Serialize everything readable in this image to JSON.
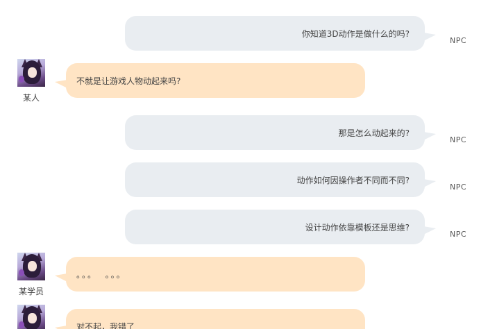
{
  "colors": {
    "npc_bubble": "#e9edf1",
    "user_bubble": "#ffe4c4",
    "text": "#444444",
    "background": "#ffffff"
  },
  "messages": [
    {
      "role": "npc",
      "text": "你知道3D动作是做什么的吗?",
      "speaker": "NPC"
    },
    {
      "role": "user",
      "text": "不就是让游戏人物动起来吗?",
      "speaker": "某人",
      "avatar_icon": "anime-girl-avatar-icon"
    },
    {
      "role": "npc",
      "text": "那是怎么动起来的?",
      "speaker": "NPC"
    },
    {
      "role": "npc",
      "text": "动作如何因操作者不同而不同?",
      "speaker": "NPC"
    },
    {
      "role": "npc",
      "text": "设计动作依靠模板还是思维?",
      "speaker": "NPC"
    },
    {
      "role": "user",
      "text": "。。。  。。。",
      "speaker": "某学员",
      "avatar_icon": "anime-girl-avatar-icon"
    },
    {
      "role": "user",
      "text": "对不起，我错了",
      "speaker": "",
      "avatar_icon": "anime-girl-avatar-icon"
    }
  ]
}
